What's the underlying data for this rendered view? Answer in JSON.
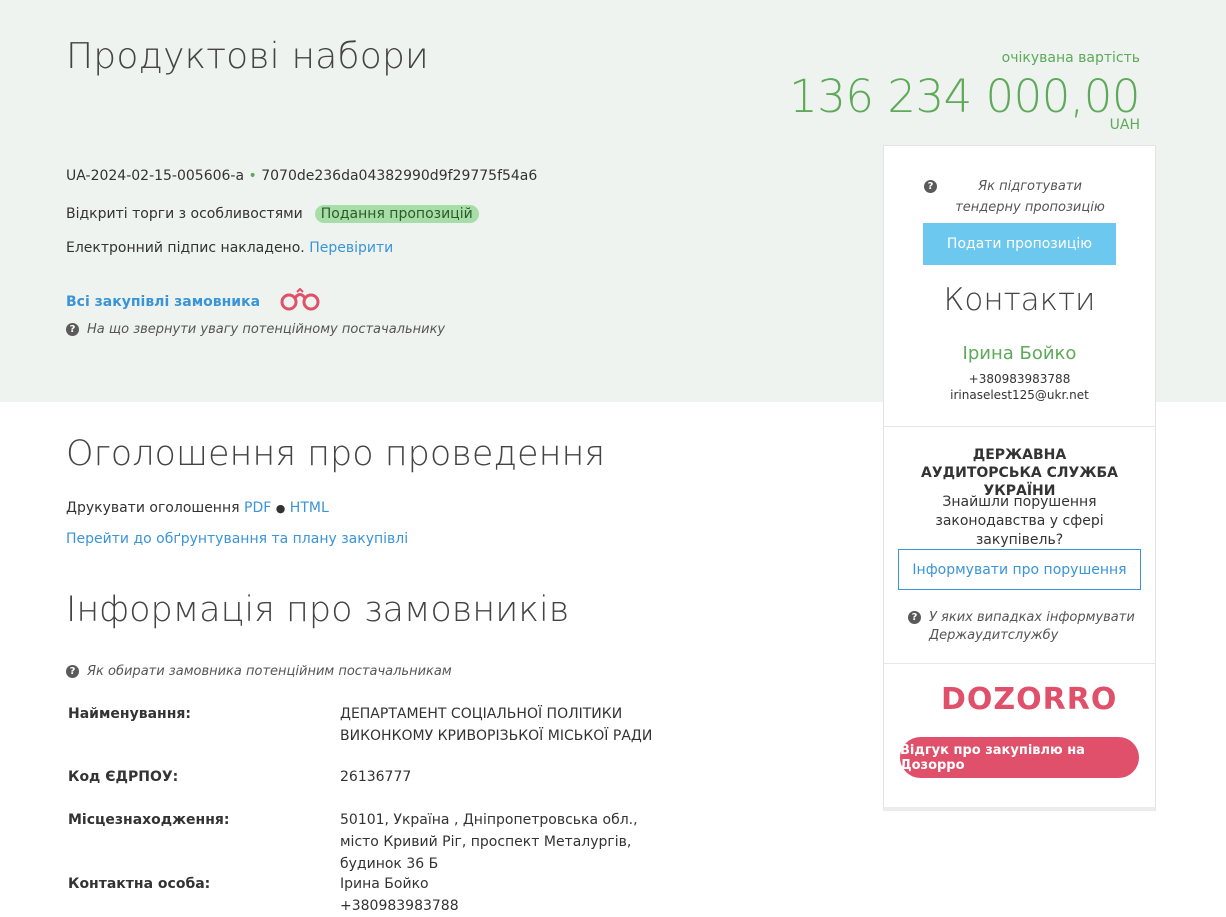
{
  "header": {
    "title": "Продуктові набори",
    "expected_label": "очікувана вартість",
    "amount": "136 234 000,00",
    "currency": "UAH"
  },
  "tender": {
    "id": "UA-2024-02-15-005606-a",
    "separator": "•",
    "hash": "7070de236da04382990d9f29775f54a6",
    "procedure_type": "Відкриті торги з особливостями",
    "status": "Подання пропозицій",
    "signature_text": "Електронний підпис накладено.",
    "verify_link": "Перевірити",
    "all_purchases_link": "Всі закупівлі замовника",
    "attention_help": "На що звернути увагу потенційному постачальнику"
  },
  "announcement": {
    "heading": "Оголошення про проведення",
    "print_label": "Друкувати оголошення",
    "pdf_link": "PDF",
    "bullet": "●",
    "html_link": "HTML",
    "plan_link": "Перейти до обґрунтування та плану закупівлі"
  },
  "customers": {
    "heading": "Інформація про замовників",
    "help": "Як обирати замовника потенційним постачальникам",
    "rows": [
      {
        "label": "Найменування:",
        "value": "ДЕПАРТАМЕНТ СОЦІАЛЬНОЇ ПОЛІТИКИ ВИКОНКОМУ КРИВОРІЗЬКОЇ МІСЬКОЇ РАДИ"
      },
      {
        "label": "Код ЄДРПОУ:",
        "value": "26136777"
      },
      {
        "label": "Місцезнаходження:",
        "value": "50101, Україна , Дніпропетровська обл., місто Кривий Ріг, проспект Металургів, будинок 36 Б"
      },
      {
        "label": "Контактна особа:",
        "value": "Ірина Бойко",
        "value2": "+380983983788"
      }
    ]
  },
  "sidebar": {
    "prepare_help": "Як підготувати тендерну пропозицію",
    "submit_button": "Подати пропозицію",
    "contacts_heading": "Контакти",
    "contact_name": "Ірина Бойко",
    "contact_phone": "+380983983788",
    "contact_email": "irinaselest125@ukr.net",
    "audit_title": "ДЕРЖАВНА АУДИТОРСЬКА СЛУЖБА УКРАЇНИ",
    "audit_question": "Знайшли порушення законодавства у сфері закупівель?",
    "report_button": "Інформувати про порушення",
    "report_help": "У яких випадках інформувати Держаудитслужбу",
    "dozorro_logo": "DOZORRO",
    "dozorro_button": "Відгук про закупівлю на Дозорро"
  },
  "colors": {
    "accent_green": "#5ea95a",
    "link_blue": "#3a94d8",
    "button_blue": "#6cc8ee",
    "dozorro_red": "#e0506a",
    "status_badge": "#a7dea7"
  },
  "icons": {
    "binoculars": "binoculars-icon",
    "help": "question-circle-icon"
  }
}
